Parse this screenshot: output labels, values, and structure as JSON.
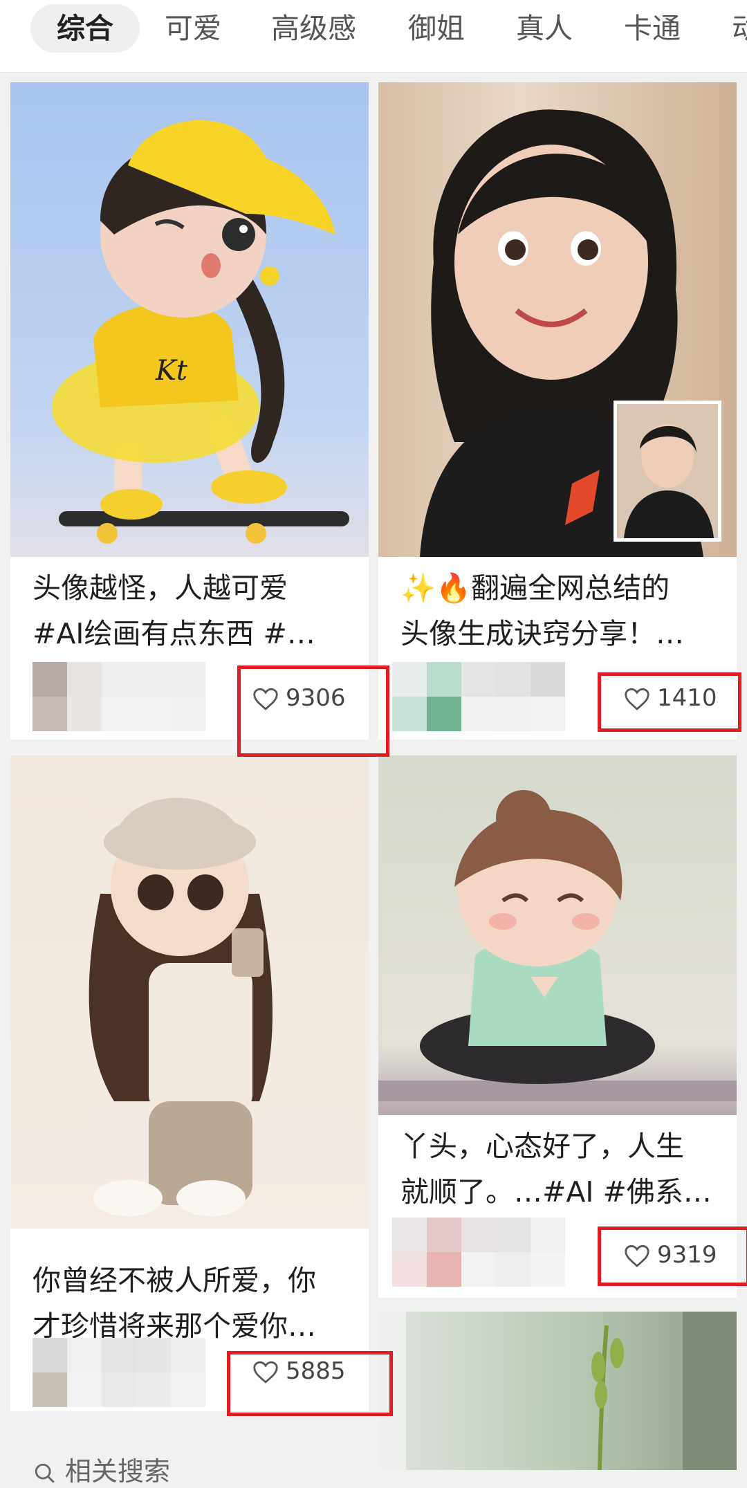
{
  "tabs": [
    "综合",
    "可爱",
    "高级感",
    "御姐",
    "真人",
    "卡通",
    "动"
  ],
  "cards": [
    {
      "title_line1": "头像越怪，人越可爱",
      "title_line2": "#AI绘画有点东西 #…",
      "likes": "9306"
    },
    {
      "title_line1": "✨🔥翻遍全网总结的",
      "title_line2": "头像生成诀窍分享！…",
      "likes": "1410"
    },
    {
      "title_line1": "你曾经不被人所爱，你",
      "title_line2": "才珍惜将来那个爱你…",
      "likes": "5885"
    },
    {
      "title_line1": "丫头，心态好了，人生",
      "title_line2": "就顺了。…#AI #佛系…",
      "likes": "9319"
    }
  ],
  "related_search": "相关搜索",
  "icons": {
    "like": "heart-outline-icon",
    "search": "search-icon"
  },
  "colors": {
    "highlight": "#e11d23",
    "active_tab_bg": "#efefef"
  }
}
